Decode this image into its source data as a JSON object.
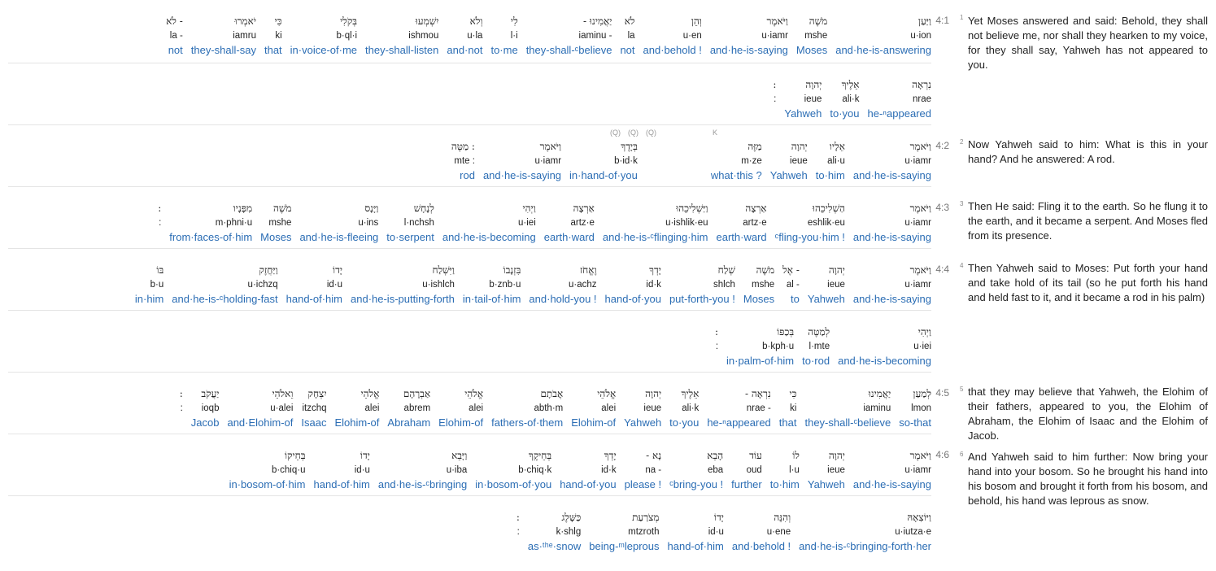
{
  "verses": [
    {
      "ref": "4:1",
      "lines": [
        {
          "words": [
            {
              "heb": "וַיַּעַן",
              "tr": "u·ion",
              "en": "and·he-is-answering"
            },
            {
              "heb": "מֹשֶׁה",
              "tr": "mshe",
              "en": "Moses"
            },
            {
              "heb": "וַיֹּאמֶר",
              "tr": "u·iamr",
              "en": "and·he-is-saying"
            },
            {
              "heb": "וְהֵן",
              "tr": "u·en",
              "en": "and·behold !"
            },
            {
              "heb": "לֹא",
              "tr": "la",
              "en": "not"
            },
            {
              "heb": "- יַאֲמִינוּ",
              "tr": "iaminu -",
              "en": "they-shall-ᶜbelieve"
            },
            {
              "heb": "לִי",
              "tr": "l·i",
              "en": "to·me"
            },
            {
              "heb": "וְלֹא",
              "tr": "u·la",
              "en": "and·not"
            },
            {
              "heb": "יִשְׁמְעוּ",
              "tr": "ishmou",
              "en": "they-shall-listen"
            },
            {
              "heb": "בְּקֹלִי",
              "tr": "b·ql·i",
              "en": "in·voice-of·me"
            },
            {
              "heb": "כִּי",
              "tr": "ki",
              "en": "that"
            },
            {
              "heb": "יֹאמְרוּ",
              "tr": "iamru",
              "en": "they-shall-say"
            },
            {
              "heb": "לֹא -",
              "tr": "la -",
              "en": "not"
            }
          ]
        },
        {
          "words": [
            {
              "heb": "נִרְאָה",
              "tr": "nrae",
              "en": "he-ⁿappeared"
            },
            {
              "heb": "אֵלֶיךָ",
              "tr": "ali·k",
              "en": "to·you"
            },
            {
              "heb": "יְהוָה",
              "tr": "ieue",
              "en": "Yahweh"
            },
            {
              "heb": ":",
              "tr": ":",
              "en": ""
            }
          ]
        }
      ],
      "translation": "Yet Moses answered and said: Behold, they shall not believe me, nor shall they hearken to my voice, for they shall say, Yahweh has not appeared to you."
    },
    {
      "ref": "4:2",
      "lines": [
        {
          "words": [
            {
              "heb": "וַיֹּאמֶר",
              "tr": "u·iamr",
              "en": "and·he-is-saying"
            },
            {
              "heb": "אֵלָיו",
              "tr": "ali·u",
              "en": "to·him"
            },
            {
              "heb": "יְהוָה",
              "tr": "ieue",
              "en": "Yahweh"
            },
            {
              "heb": "מַזֶּה",
              "tr": "m·ze",
              "en": "what·this ?"
            },
            {
              "heb": "",
              "tr": "",
              "en": ""
            },
            {
              "heb": "בְּיָדֶךָ",
              "tr": "b·id·k",
              "en": "in·hand-of·you"
            },
            {
              "heb": "וַיֹּאמֶר",
              "tr": "u·iamr",
              "en": "and·he-is-saying"
            },
            {
              "heb": "מַטֶּה :",
              "tr": "mte :",
              "en": "rod"
            }
          ]
        }
      ],
      "translation": "Now Yahweh said to him: What is this in your hand? And he answered: A rod."
    },
    {
      "ref": "4:3",
      "lines": [
        {
          "words": [
            {
              "heb": "וַיֹּאמֶר",
              "tr": "u·iamr",
              "en": "and·he-is-saying"
            },
            {
              "heb": "הַשְׁלִיכֵהוּ",
              "tr": "eshlik·eu",
              "en": "ᶜfling-you·him !"
            },
            {
              "heb": "אַרְצָה",
              "tr": "artz·e",
              "en": "earth·ward"
            },
            {
              "heb": "וַיַּשְׁלִיכֵהוּ",
              "tr": "u·ishlik·eu",
              "en": "and·he-is-ᶜflinging·him"
            },
            {
              "heb": "אַרְצָה",
              "tr": "artz·e",
              "en": "earth·ward"
            },
            {
              "heb": "וַיְהִי",
              "tr": "u·iei",
              "en": "and·he-is-becoming"
            },
            {
              "heb": "לְנָחָשׁ",
              "tr": "l·nchsh",
              "en": "to·serpent"
            },
            {
              "heb": "וַיָּנָס",
              "tr": "u·ins",
              "en": "and·he-is-fleeing"
            },
            {
              "heb": "מֹשֶׁה",
              "tr": "mshe",
              "en": "Moses"
            },
            {
              "heb": "מִפָּנָיו",
              "tr": "m·phni·u",
              "en": "from·faces-of·him"
            },
            {
              "heb": ":",
              "tr": ":",
              "en": ""
            }
          ]
        }
      ],
      "translation": "Then He said: Fling it to the earth. So he flung it to the earth, and it became a serpent. And Moses fled from its presence."
    },
    {
      "ref": "4:4",
      "lines": [
        {
          "words": [
            {
              "heb": "וַיֹּאמֶר",
              "tr": "u·iamr",
              "en": "and·he-is-saying"
            },
            {
              "heb": "יְהוָה",
              "tr": "ieue",
              "en": "Yahweh"
            },
            {
              "heb": "אֶל -",
              "tr": "al -",
              "en": "to"
            },
            {
              "heb": "מֹשֶׁה",
              "tr": "mshe",
              "en": "Moses"
            },
            {
              "heb": "שְׁלַח",
              "tr": "shlch",
              "en": "put-forth-you !"
            },
            {
              "heb": "יָדְךָ",
              "tr": "id·k",
              "en": "hand-of·you"
            },
            {
              "heb": "וֶאֱחֹז",
              "tr": "u·achz",
              "en": "and·hold-you !"
            },
            {
              "heb": "בִּזְנָבוֹ",
              "tr": "b·znb·u",
              "en": "in·tail-of·him"
            },
            {
              "heb": "וַיִּשְׁלַח",
              "tr": "u·ishlch",
              "en": "and·he-is-putting-forth"
            },
            {
              "heb": "יָדוֹ",
              "tr": "id·u",
              "en": "hand-of·him"
            },
            {
              "heb": "וַיַּחֲזֶק",
              "tr": "u·ichzq",
              "en": "and·he-is-ᶜholding-fast"
            },
            {
              "heb": "בּוֹ",
              "tr": "b·u",
              "en": "in·him"
            }
          ]
        },
        {
          "words": [
            {
              "heb": "וַיְהִי",
              "tr": "u·iei",
              "en": "and·he-is-becoming"
            },
            {
              "heb": "לְמַטֶּה",
              "tr": "l·mte",
              "en": "to·rod"
            },
            {
              "heb": "בְּכַפּוֹ",
              "tr": "b·kph·u",
              "en": "in·palm-of·him"
            },
            {
              "heb": ":",
              "tr": ":",
              "en": ""
            }
          ]
        }
      ],
      "translation": "Then Yahweh said to Moses: Put forth your hand and take hold of its tail (so he put forth his hand and held fast to it, and it became a rod in his palm)"
    },
    {
      "ref": "4:5",
      "lines": [
        {
          "words": [
            {
              "heb": "לְמַעַן",
              "tr": "lmon",
              "en": "so-that"
            },
            {
              "heb": "יַאֲמִינוּ",
              "tr": "iaminu",
              "en": "they-shall-ᶜbelieve"
            },
            {
              "heb": "כִּי",
              "tr": "ki",
              "en": "that"
            },
            {
              "heb": "- נִרְאָה",
              "tr": "nrae -",
              "en": "he-ⁿappeared"
            },
            {
              "heb": "אֵלֶיךָ",
              "tr": "ali·k",
              "en": "to·you"
            },
            {
              "heb": "יְהוָה",
              "tr": "ieue",
              "en": "Yahweh"
            },
            {
              "heb": "אֱלֹהֵי",
              "tr": "alei",
              "en": "Elohim-of"
            },
            {
              "heb": "אֲבֹתָם",
              "tr": "abth·m",
              "en": "fathers-of·them"
            },
            {
              "heb": "אֱלֹהֵי",
              "tr": "alei",
              "en": "Elohim-of"
            },
            {
              "heb": "אַבְרָהָם",
              "tr": "abrem",
              "en": "Abraham"
            },
            {
              "heb": "אֱלֹהֵי",
              "tr": "alei",
              "en": "Elohim-of"
            },
            {
              "heb": "יִצְחָק",
              "tr": "itzchq",
              "en": "Isaac"
            },
            {
              "heb": "וֵאלֹהֵי",
              "tr": "u·alei",
              "en": "and·Elohim-of"
            },
            {
              "heb": "יַעֲקֹב",
              "tr": "ioqb",
              "en": "Jacob"
            },
            {
              "heb": ":",
              "tr": ":",
              "en": ""
            }
          ]
        }
      ],
      "translation": "that they may believe that Yahweh, the Elohim of their fathers, appeared to you, the Elohim of Abraham, the Elohim of Isaac and the Elohim of Jacob."
    },
    {
      "ref": "4:6",
      "lines": [
        {
          "words": [
            {
              "heb": "וַיֹּאמֶר",
              "tr": "u·iamr",
              "en": "and·he-is-saying"
            },
            {
              "heb": "יְהוָה",
              "tr": "ieue",
              "en": "Yahweh"
            },
            {
              "heb": "לוֹ",
              "tr": "l·u",
              "en": "to·him"
            },
            {
              "heb": "עוֹד",
              "tr": "oud",
              "en": "further"
            },
            {
              "heb": "הָבֵא",
              "tr": "eba",
              "en": "ᶜbring-you !"
            },
            {
              "heb": "- נָא",
              "tr": "na -",
              "en": "please !"
            },
            {
              "heb": "יָדְךָ",
              "tr": "id·k",
              "en": "hand-of·you"
            },
            {
              "heb": "בְּחֵיקֶךָ",
              "tr": "b·chiq·k",
              "en": "in·bosom-of·you"
            },
            {
              "heb": "וַיָּבֵא",
              "tr": "u·iba",
              "en": "and·he-is-ᶜbringing"
            },
            {
              "heb": "יָדוֹ",
              "tr": "id·u",
              "en": "hand-of·him"
            },
            {
              "heb": "בְּחֵיקוֹ",
              "tr": "b·chiq·u",
              "en": "in·bosom-of·him"
            }
          ]
        },
        {
          "words": [
            {
              "heb": "וַיּוֹצִאָהּ",
              "tr": "u·iutza·e",
              "en": "and·he-is-ᶜbringing-forth·her"
            },
            {
              "heb": "וְהִנֵּה",
              "tr": "u·ene",
              "en": "and·behold !"
            },
            {
              "heb": "יָדוֹ",
              "tr": "id·u",
              "en": "hand-of·him"
            },
            {
              "heb": "מְצֹרַעַת",
              "tr": "mtzroth",
              "en": "being-ᵐleprous"
            },
            {
              "heb": "כַּשָּׁלֶג",
              "tr": "k·shlg",
              "en": "as·ᵗʰᵉ·snow"
            },
            {
              "heb": ":",
              "tr": ":",
              "en": ""
            }
          ]
        }
      ],
      "translation": "And Yahweh said to him further: Now bring your hand into your bosom. So he brought his hand into his bosom and brought it forth from his bosom, and behold, his hand was leprous as snow."
    }
  ],
  "verse_numbers": [
    "1",
    "2",
    "3",
    "4",
    "5",
    "6"
  ],
  "marks": {
    "q1": "(Q)",
    "q2": "(Q)",
    "q3": "(Q)",
    "k": "K"
  }
}
